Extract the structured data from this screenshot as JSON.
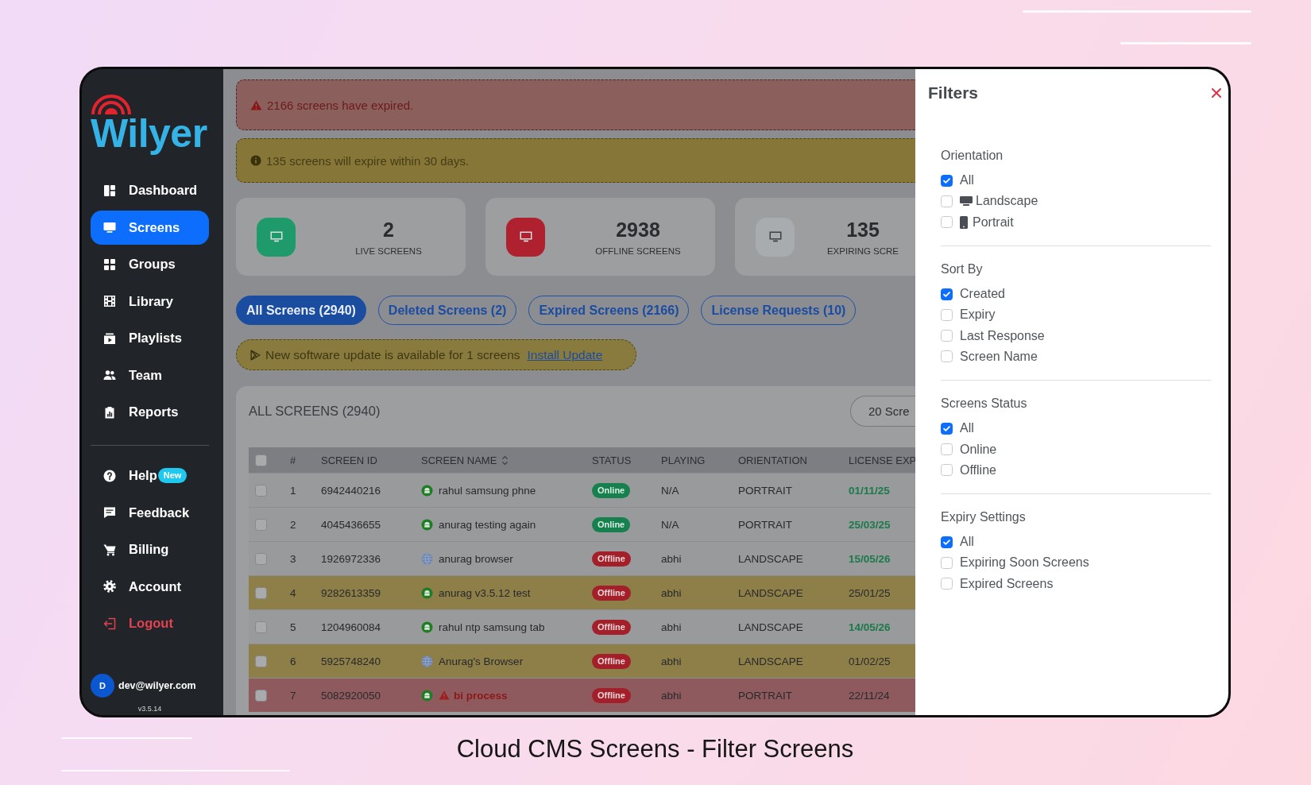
{
  "sidebar": {
    "logo": "Wilyer",
    "items": [
      {
        "label": "Dashboard",
        "selected": false
      },
      {
        "label": "Screens",
        "selected": true
      },
      {
        "label": "Groups",
        "selected": false
      },
      {
        "label": "Library",
        "selected": false
      },
      {
        "label": "Playlists",
        "selected": false
      },
      {
        "label": "Team",
        "selected": false
      },
      {
        "label": "Reports",
        "selected": false
      }
    ],
    "bottom_items": [
      {
        "label": "Help",
        "kind": "normal",
        "badge": "New",
        "selected": false
      },
      {
        "label": "Feedback",
        "kind": "normal",
        "selected": false
      },
      {
        "label": "Billing",
        "kind": "normal",
        "selected": false
      },
      {
        "label": "Account",
        "kind": "normal",
        "selected": false
      },
      {
        "label": "Logout",
        "kind": "danger",
        "selected": false
      }
    ],
    "user": {
      "initial": "D",
      "email": "dev@wilyer.com"
    },
    "version": "v3.5.14"
  },
  "alerts": [
    {
      "kind": "danger",
      "text": "2166 screens have expired."
    },
    {
      "kind": "warning",
      "text": "135 screens will expire within 30 days."
    }
  ],
  "stats": [
    {
      "value": "2",
      "label": "LIVE SCREENS",
      "color": "#1f9a6b"
    },
    {
      "value": "2938",
      "label": "OFFLINE SCREENS",
      "color": "#b0212f"
    },
    {
      "value": "135",
      "label": "EXPIRING SCRE",
      "color": "#a9acaf"
    }
  ],
  "tabs": [
    {
      "label": "All Screens (2940)",
      "selected": true
    },
    {
      "label": "Deleted Screens (2)",
      "selected": false
    },
    {
      "label": "Expired Screens (2166)",
      "selected": false
    },
    {
      "label": "License Requests (10)",
      "selected": false
    }
  ],
  "update_notice": {
    "text": "New software update is available for 1 screens",
    "link": "Install Update"
  },
  "table": {
    "title": "ALL SCREENS (2940)",
    "page_size": "20 Scre",
    "select_all": {
      "checked": false
    },
    "columns": [
      {
        "label": "#",
        "sortable": false
      },
      {
        "label": "SCREEN ID",
        "sortable": false
      },
      {
        "label": "SCREEN NAME",
        "sortable": true
      },
      {
        "label": "STATUS",
        "sortable": false
      },
      {
        "label": "PLAYING",
        "sortable": false
      },
      {
        "label": "ORIENTATION",
        "sortable": false
      },
      {
        "label": "LICENSE EXP",
        "sortable": false
      }
    ],
    "rows": [
      {
        "checked": false,
        "number": "1",
        "screen_id": "6942440216",
        "kind": "app",
        "name": "rahul samsung phne",
        "online": true,
        "status": "Online",
        "playing": "N/A",
        "orientation": "PORTRAIT",
        "license_expiry": "01/11/25",
        "expiring_soon": false,
        "expired": false
      },
      {
        "checked": false,
        "number": "2",
        "screen_id": "4045436655",
        "kind": "app",
        "name": "anurag testing again",
        "online": true,
        "status": "Online",
        "playing": "N/A",
        "orientation": "PORTRAIT",
        "license_expiry": "25/03/25",
        "expiring_soon": false,
        "expired": false
      },
      {
        "checked": false,
        "number": "3",
        "screen_id": "1926972336",
        "kind": "browser",
        "name": "anurag browser",
        "online": false,
        "status": "Offline",
        "playing": "abhi",
        "orientation": "LANDSCAPE",
        "license_expiry": "15/05/26",
        "expiring_soon": false,
        "expired": false
      },
      {
        "checked": false,
        "number": "4",
        "screen_id": "9282613359",
        "kind": "app",
        "name": "anurag v3.5.12 test",
        "online": false,
        "status": "Offline",
        "playing": "abhi",
        "orientation": "LANDSCAPE",
        "license_expiry": "25/01/25",
        "expiring_soon": true,
        "expired": false
      },
      {
        "checked": false,
        "number": "5",
        "screen_id": "1204960084",
        "kind": "app",
        "name": "rahul ntp samsung tab",
        "online": false,
        "status": "Offline",
        "playing": "abhi",
        "orientation": "LANDSCAPE",
        "license_expiry": "14/05/26",
        "expiring_soon": false,
        "expired": false
      },
      {
        "checked": false,
        "number": "6",
        "screen_id": "5925748240",
        "kind": "browser",
        "name": "Anurag's Browser",
        "online": false,
        "status": "Offline",
        "playing": "abhi",
        "orientation": "LANDSCAPE",
        "license_expiry": "01/02/25",
        "expiring_soon": true,
        "expired": false
      },
      {
        "checked": false,
        "number": "7",
        "screen_id": "5082920050",
        "kind": "app",
        "name": "bi process",
        "online": false,
        "status": "Offline",
        "playing": "abhi",
        "orientation": "PORTRAIT",
        "license_expiry": "22/11/24",
        "expiring_soon": false,
        "expired": true
      }
    ]
  },
  "filters": {
    "title": "Filters",
    "sections": [
      {
        "title": "Orientation",
        "options": [
          {
            "label": "All",
            "checked": true
          },
          {
            "label": "Landscape",
            "checked": false
          },
          {
            "label": "Portrait",
            "checked": false
          }
        ]
      },
      {
        "title": "Sort By",
        "options": [
          {
            "label": "Created",
            "checked": true
          },
          {
            "label": "Expiry",
            "checked": false
          },
          {
            "label": "Last Response",
            "checked": false
          },
          {
            "label": "Screen Name",
            "checked": false
          }
        ]
      },
      {
        "title": "Screens Status",
        "options": [
          {
            "label": "All",
            "checked": true
          },
          {
            "label": "Online",
            "checked": false
          },
          {
            "label": "Offline",
            "checked": false
          }
        ]
      },
      {
        "title": "Expiry Settings",
        "options": [
          {
            "label": "All",
            "checked": true
          },
          {
            "label": "Expiring Soon Screens",
            "checked": false
          },
          {
            "label": "Expired Screens",
            "checked": false
          }
        ]
      }
    ]
  },
  "caption": "Cloud CMS Screens - Filter Screens"
}
